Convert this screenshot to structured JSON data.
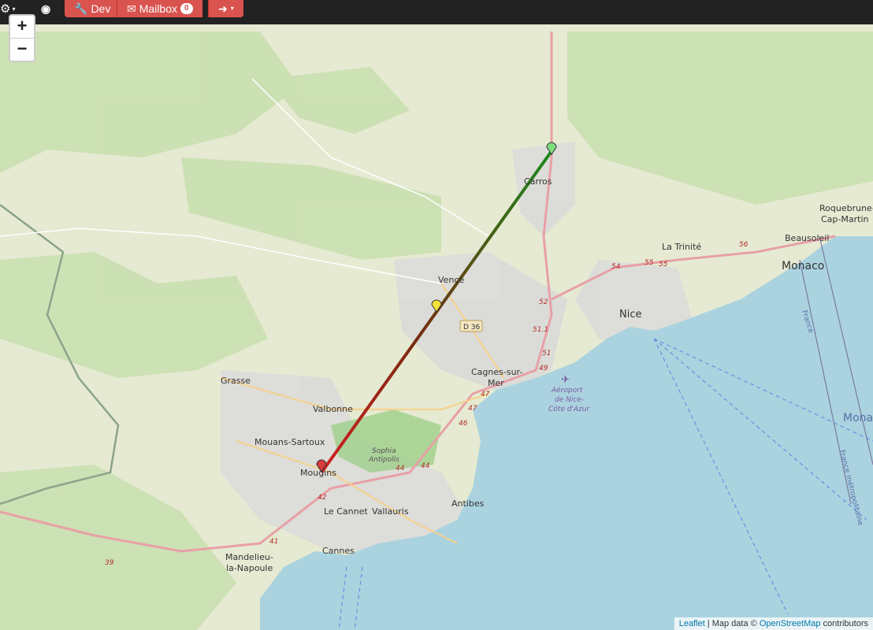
{
  "topbar": {
    "dev_label": "Dev",
    "mailbox_label": "Mailbox",
    "mailbox_count": "0"
  },
  "zoom": {
    "in_label": "+",
    "out_label": "−"
  },
  "map": {
    "places": {
      "carros": "Carros",
      "la_trinite": "La Trinité",
      "roquebrune": "Roquebrune-",
      "cap_martin": "Cap-Martin",
      "beausoleil": "Beausoleil",
      "monaco": "Monaco",
      "monaco_sea": "Mona",
      "vence": "Vence",
      "d36": "D 36",
      "nice": "Nice",
      "cagnes1": "Cagnes-sur-",
      "cagnes2": "Mer",
      "airport1": "Aéroport",
      "airport2": "de Nice-",
      "airport3": "Côte d'Azur",
      "grasse": "Grasse",
      "valbonne": "Valbonne",
      "mouans": "Mouans-Sartoux",
      "sophia1": "Sophia",
      "sophia2": "Antipolis",
      "mougins": "Mougins",
      "le_cannet": "Le Cannet",
      "vallauris": "Vallauris",
      "antibes": "Antibes",
      "cannes": "Cannes",
      "mandelieu1": "Mandelieu-",
      "mandelieu2": "la-Napoule",
      "france_border": "France",
      "france_metro": "France métropolitaine"
    },
    "road_numbers": {
      "r54": "54",
      "r55a": "55",
      "r55b": "55",
      "r56": "56",
      "r52": "52",
      "r511": "51.1",
      "r51": "51",
      "r49": "49",
      "r47a": "47",
      "r47b": "47",
      "r46": "46",
      "r44a": "44",
      "r44b": "44",
      "r42": "42",
      "r41": "41",
      "r39": "39"
    },
    "markers": [
      {
        "name": "start",
        "color": "#7ddf7d"
      },
      {
        "name": "mid",
        "color": "#f2e33a"
      },
      {
        "name": "end",
        "color": "#d63b3b"
      }
    ]
  },
  "attribution": {
    "leaflet": "Leaflet",
    "sep": " | Map data © ",
    "osm": "OpenStreetMap",
    "contributors": " contributors"
  },
  "colors": {
    "sea": "#aad3df",
    "land": "#e9ecd9",
    "forest": "#c6deac",
    "urban": "#dcdcdc",
    "accent": "#d9534f"
  }
}
